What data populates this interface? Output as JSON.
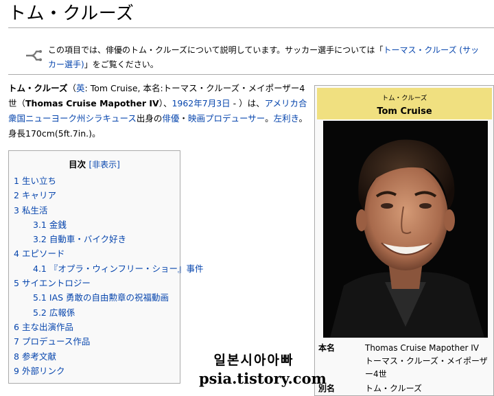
{
  "page": {
    "title": "トム・クルーズ"
  },
  "hatnote": {
    "text_before": "この項目では、俳優のトム・クルーズについて説明しています。サッカー選手については「",
    "link": "トーマス・クルーズ (サッカー選手)",
    "text_after": "」をご覧ください。"
  },
  "lead": {
    "bold_name": "トム・クルーズ",
    "paren_open": "（",
    "lang_link": "英",
    "colon": ": Tom Cruise, 本名:トーマス・クルーズ・メイポーザー4世（",
    "bold_full_name": "Thomas Cruise Mapother IV",
    "after_bold": "）、",
    "birth_link": "1962年7月3日",
    "dash": " - ）は、",
    "origin_link": "アメリカ合衆国ニューヨーク州シラキュース",
    "origin_after": "出身の",
    "actor_link": "俳優",
    "sep": "・",
    "film_link": "映画プロデューサー",
    "period": "。",
    "lefty_link": "左利き",
    "height_text": "。身長170cm(5ft.7in.)。"
  },
  "toc": {
    "title": "目次",
    "toggle": "[非表示]",
    "items": [
      {
        "num": "1",
        "label": "生い立ち",
        "level": 1
      },
      {
        "num": "2",
        "label": "キャリア",
        "level": 1
      },
      {
        "num": "3",
        "label": "私生活",
        "level": 1
      },
      {
        "num": "3.1",
        "label": "金銭",
        "level": 2
      },
      {
        "num": "3.2",
        "label": "自動車・バイク好き",
        "level": 2
      },
      {
        "num": "4",
        "label": "エピソード",
        "level": 1
      },
      {
        "num": "4.1",
        "label": "『オプラ・ウィンフリー・ショー』事件",
        "level": 2
      },
      {
        "num": "5",
        "label": "サイエントロジー",
        "level": 1
      },
      {
        "num": "5.1",
        "label": "IAS 勇敢の自由勲章の祝福動画",
        "level": 2
      },
      {
        "num": "5.2",
        "label": "広報係",
        "level": 2
      },
      {
        "num": "6",
        "label": "主な出演作品",
        "level": 1
      },
      {
        "num": "7",
        "label": "プロデュース作品",
        "level": 1
      },
      {
        "num": "8",
        "label": "参考文献",
        "level": 1
      },
      {
        "num": "9",
        "label": "外部リンク",
        "level": 1
      }
    ]
  },
  "infobox": {
    "subtitle": "トム・クルーズ",
    "name": "Tom Cruise",
    "real_name_key": "本名",
    "real_name_line1": "Thomas Cruise Mapother IV",
    "real_name_line2": "トーマス・クルーズ・メイポーザー4世",
    "alias_key": "別名",
    "alias_value": "トム・クルーズ",
    "header_color": "#f0e080"
  },
  "watermark": {
    "line1": "일본시아아빠",
    "line2": "psia.tistory.com"
  }
}
